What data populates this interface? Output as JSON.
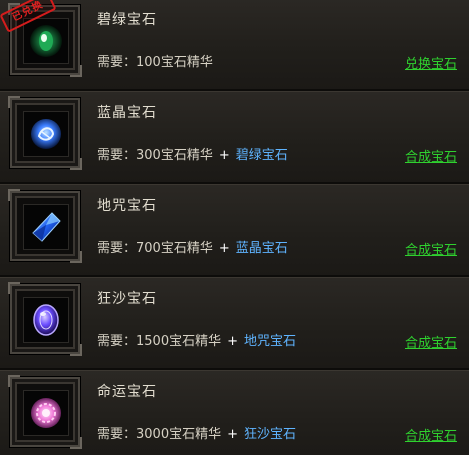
{
  "rows": [
    {
      "name": "碧绿宝石",
      "req_label": "需要：",
      "cost": "100宝石精华",
      "plus": "",
      "gem_ref": "",
      "action": "兑换宝石",
      "badge": "已兑换",
      "gem_icon": "green-gem-icon",
      "gem_color": "#26d36a"
    },
    {
      "name": "蓝晶宝石",
      "req_label": "需要：",
      "cost": "300宝石精华",
      "plus": "+",
      "gem_ref": "碧绿宝石",
      "action": "合成宝石",
      "gem_icon": "blue-crystal-gem-icon",
      "gem_color": "#3b7dff"
    },
    {
      "name": "地咒宝石",
      "req_label": "需要：",
      "cost": "700宝石精华",
      "plus": "+",
      "gem_ref": "蓝晶宝石",
      "action": "合成宝石",
      "gem_icon": "sapphire-gem-icon",
      "gem_color": "#1f5ff0"
    },
    {
      "name": "狂沙宝石",
      "req_label": "需要：",
      "cost": "1500宝石精华",
      "plus": "+",
      "gem_ref": "地咒宝石",
      "action": "合成宝石",
      "gem_icon": "purple-oval-gem-icon",
      "gem_color": "#6a4cff"
    },
    {
      "name": "命运宝石",
      "req_label": "需要：",
      "cost": "3000宝石精华",
      "plus": "+",
      "gem_ref": "狂沙宝石",
      "action": "合成宝石",
      "gem_icon": "pink-orb-gem-icon",
      "gem_color": "#f07ad8"
    }
  ]
}
